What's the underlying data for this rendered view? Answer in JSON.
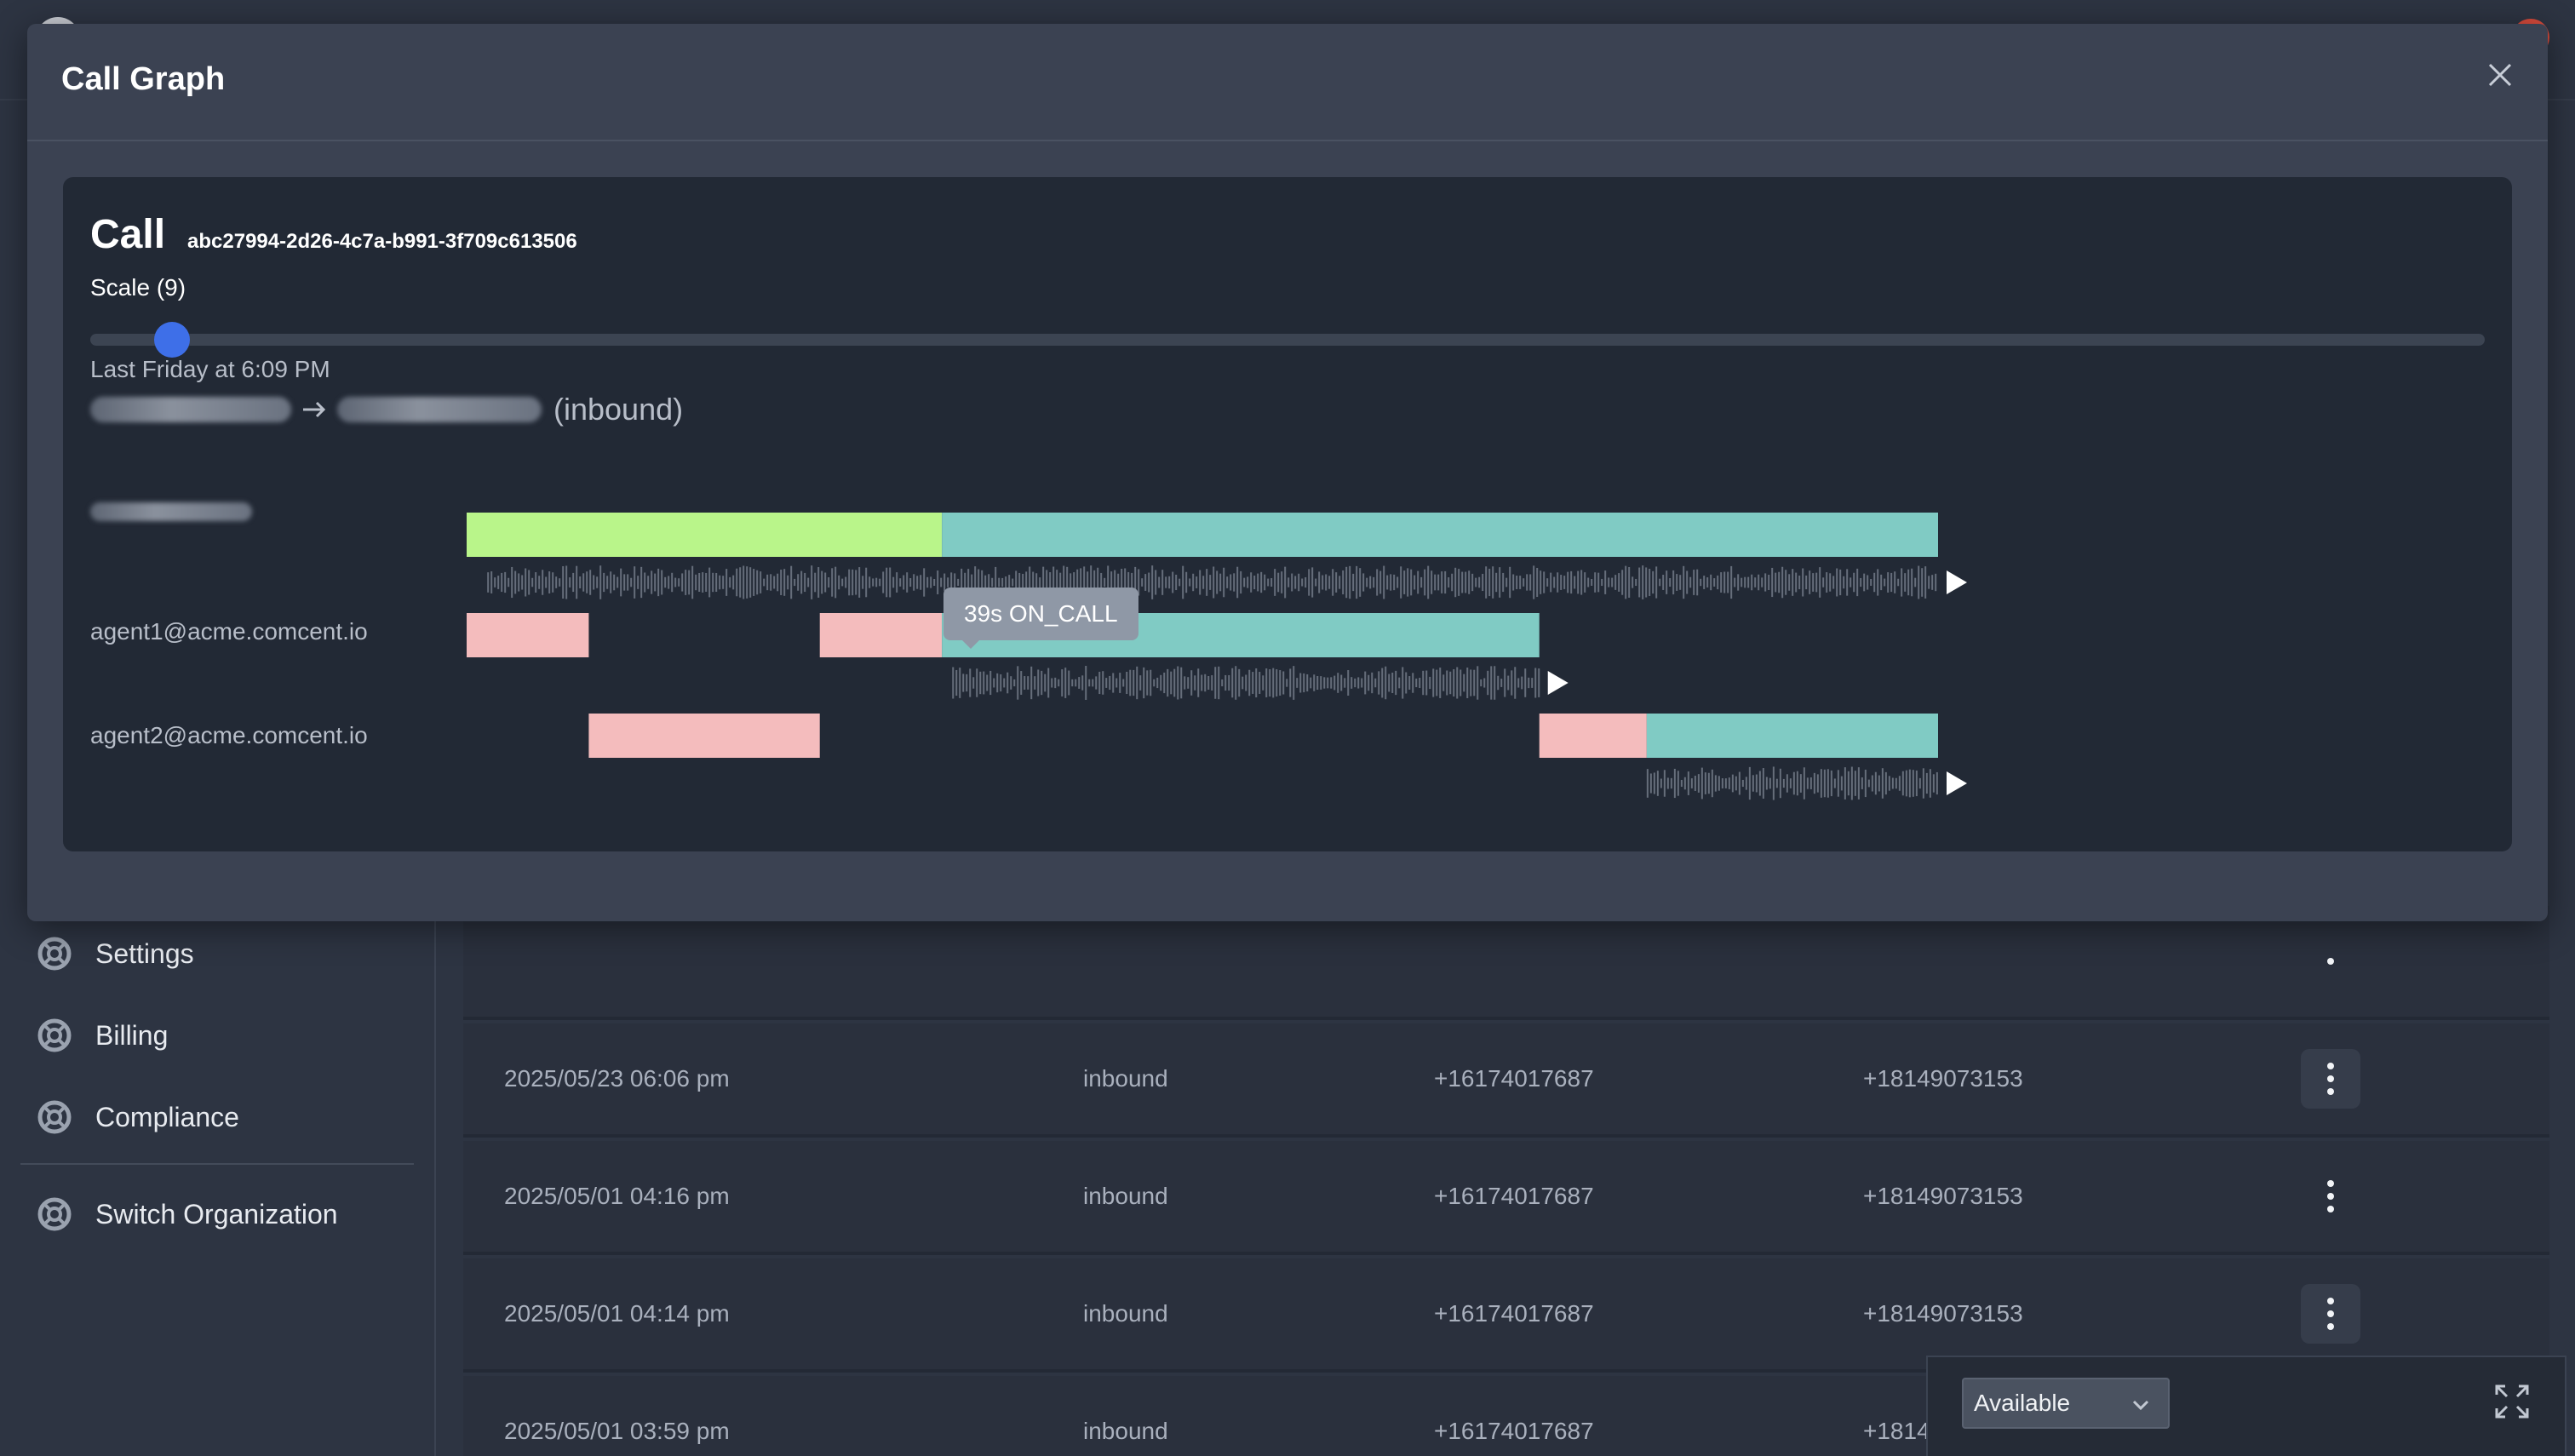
{
  "sidebar": {
    "items": [
      {
        "label": "Settings",
        "icon": "lifebuoy-icon"
      },
      {
        "label": "Billing",
        "icon": "lifebuoy-icon"
      },
      {
        "label": "Compliance",
        "icon": "lifebuoy-icon"
      },
      {
        "label": "Switch Organization",
        "icon": "lifebuoy-icon"
      }
    ]
  },
  "calls_table": {
    "rows": [
      {
        "date": "",
        "direction": "",
        "from": "",
        "to": ""
      },
      {
        "date": "2025/05/23 06:06 pm",
        "direction": "inbound",
        "from": "+16174017687",
        "to": "+18149073153"
      },
      {
        "date": "2025/05/01 04:16 pm",
        "direction": "inbound",
        "from": "+16174017687",
        "to": "+18149073153"
      },
      {
        "date": "2025/05/01 04:14 pm",
        "direction": "inbound",
        "from": "+16174017687",
        "to": "+18149073153"
      },
      {
        "date": "2025/05/01 03:59 pm",
        "direction": "inbound",
        "from": "+16174017687",
        "to": "+1814"
      }
    ]
  },
  "status_panel": {
    "selected": "Available"
  },
  "modal": {
    "title": "Call Graph",
    "call_word": "Call",
    "call_id": "abc27994-2d26-4c7a-b991-3f709c613506",
    "scale_label": "Scale (9)",
    "scale_value": 9,
    "scale_fraction": 0.034,
    "call_time": "Last Friday at 6:09 PM",
    "direction_label": "(inbound)",
    "tooltip": "39s ON_CALL"
  },
  "colors": {
    "ringing": "#f4bcbd",
    "on_call": "#80cbc4",
    "ivr": "#b9f58a",
    "waveform": "#666e7b",
    "accent": "#3e6fe8"
  },
  "timeline": {
    "parties": [
      {
        "label": "",
        "segments": [
          {
            "start": 0.0,
            "end": 0.323,
            "state": "ivr"
          },
          {
            "start": 0.323,
            "end": 1.0,
            "state": "on_call"
          }
        ],
        "recording": {
          "start": 0.014,
          "end": 1.0
        }
      },
      {
        "label": "agent1@acme.comcent.io",
        "segments": [
          {
            "start": 0.0,
            "end": 0.083,
            "state": "ringing"
          },
          {
            "start": 0.24,
            "end": 0.323,
            "state": "ringing"
          },
          {
            "start": 0.323,
            "end": 0.729,
            "state": "on_call"
          }
        ],
        "recording": {
          "start": 0.33,
          "end": 0.729
        }
      },
      {
        "label": "agent2@acme.comcent.io",
        "segments": [
          {
            "start": 0.083,
            "end": 0.24,
            "state": "ringing"
          },
          {
            "start": 0.729,
            "end": 0.802,
            "state": "ringing"
          },
          {
            "start": 0.802,
            "end": 1.0,
            "state": "on_call"
          }
        ],
        "recording": {
          "start": 0.802,
          "end": 1.0
        }
      }
    ]
  }
}
